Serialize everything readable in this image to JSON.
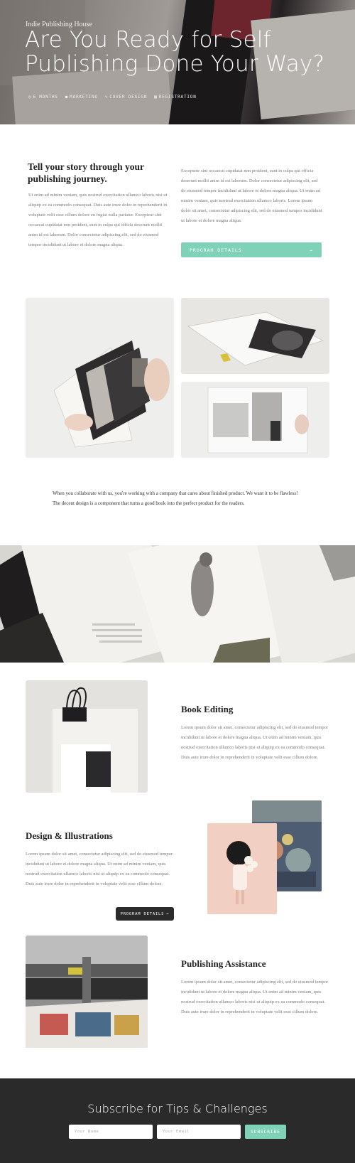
{
  "hero": {
    "eyebrow": "Indie Publishing House",
    "title": "Are You Ready for Self Publishing Done Your Way?",
    "meta": [
      {
        "icon": "clock-icon",
        "label": "6 MONTHS"
      },
      {
        "icon": "user-icon",
        "label": "MARKETING"
      },
      {
        "icon": "pencil-icon",
        "label": "COVER DESIGN"
      },
      {
        "icon": "calendar-icon",
        "label": "REGISTRATION"
      }
    ]
  },
  "intro": {
    "heading": "Tell your story through your publishing journey.",
    "left_text": "Ut enim ad minim veniam, quis nostrud exercitation ullamco laboris nisi ut aliquip ex ea commodo consequat. Duis aute irure dolor in reprehenderit in voluptate velit esse cillum dolore eu fugiat nulla pariatur. Excepteur sint occaecat cupidatat non proident, sunt in culpa qui officia deserunt mollit anim id est laborum. Dolor consectetur adipiscing elit, sed do eiusmod tempor incididunt ut labore et dolore magna aliqua.",
    "right_text": "Excepteur sint occaecat cupidatat non proident, sunt in culpa qui officia deserunt mollit anim id est laborum. Dolor consectetur adipiscing elit, sed do eiusmod tempor incididunt ut labore et dolore magna aliqua. Ut enim ad minim veniam, quis nostrud exercitation ullamco laboris. Lorem ipsum dolor sit amet, consectetur adipiscing elit, sed do eiusmod tempor incididunt ut labore et dolore magna aliqua.",
    "button_label": "PROGRAM DETAILS",
    "button_arrow": "→"
  },
  "quote": "When you collaborate with us, you're working with a company that cares about finished product. We want it to be flawless! The decent design is a component that turns a good book into the perfect product for the readers.",
  "features": [
    {
      "title": "Book Editing",
      "text": "Lorem ipsum dolor sit amet, consectetur adipiscing elit, sed do eiusmod tempor incididunt ut labore et dolore magna aliqua. Ut enim ad minim veniam, quis nostrud exercitation ullamco laboris nisi ut aliquip ex ea commodo consequat. Duis aute irure dolor in reprehenderit in voluptate velit esse cillum dolore."
    },
    {
      "title": "Design & Illustrations",
      "text": "Lorem ipsum dolor sit amet, consectetur adipiscing elit, sed do eiusmod tempor incididunt ut labore et dolore magna aliqua. Ut enim ad minim veniam, quis nostrud exercitation ullamco laboris nisi ut aliquip ex ea commodo consequat. Duis aute irure dolor in reprehenderit in voluptate velit esse cillum dolore.",
      "button_label": "PROGRAM DETAILS",
      "button_arrow": "→"
    },
    {
      "title": "Publishing Assistance",
      "text": "Lorem ipsum dolor sit amet, consectetur adipiscing elit, sed do eiusmod tempor incididunt ut labore et dolore magna aliqua. Ut enim ad minim veniam, quis nostrud exercitation ullamco laboris nisi ut aliquip ex ea commodo consequat. Duis aute irure dolor in reprehenderit in voluptate velit esse cillum dolore."
    }
  ],
  "subscribe": {
    "title": "Subscribe for Tips & Challenges",
    "name_placeholder": "Your Name",
    "email_placeholder": "Your Email",
    "button_label": "SUBSCRIBE"
  },
  "colors": {
    "accent": "#7fd1b7",
    "footer_bg": "#2a2a2a",
    "dark_button": "#2b2b2b"
  }
}
